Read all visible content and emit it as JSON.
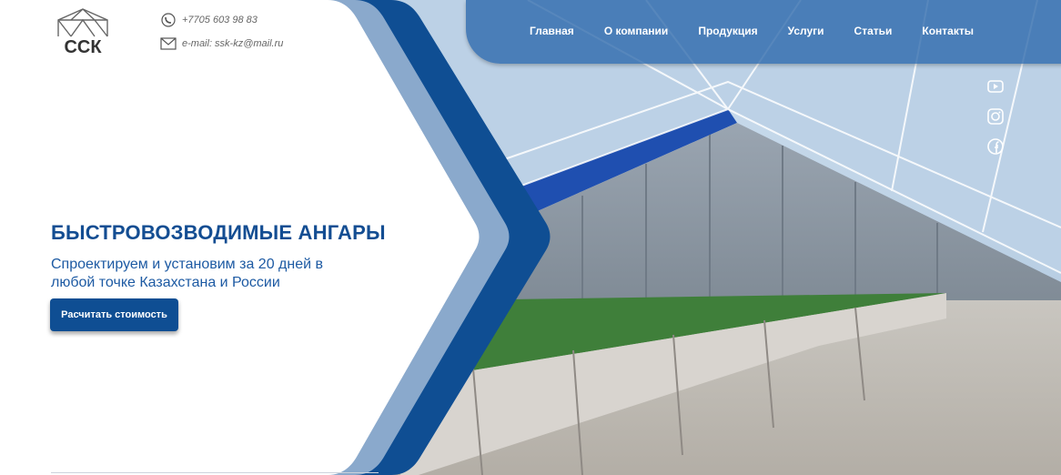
{
  "header": {
    "logo_text": "ССК",
    "phone": "+7705 603 98 83",
    "email": "e-mail: ssk-kz@mail.ru"
  },
  "nav": {
    "items": [
      {
        "label": "Главная"
      },
      {
        "label": "О компании"
      },
      {
        "label": "Продукция"
      },
      {
        "label": "Услуги"
      },
      {
        "label": "Статьи"
      },
      {
        "label": "Контакты"
      }
    ]
  },
  "social": [
    "youtube-icon",
    "instagram-icon",
    "facebook-icon"
  ],
  "hero": {
    "title": "БЫСТРОВОЗВОДИМЫЕ АНГАРЫ",
    "subtitle_line1": "Спроектируем и установим за 20 дней в",
    "subtitle_line2": "любой точке Казахстана и России",
    "cta_label": "Расчитать стоимость"
  },
  "colors": {
    "brand_dark": "#0f4e93",
    "brand_light": "#8aa9cc",
    "nav_bg": "#2a66aa"
  }
}
